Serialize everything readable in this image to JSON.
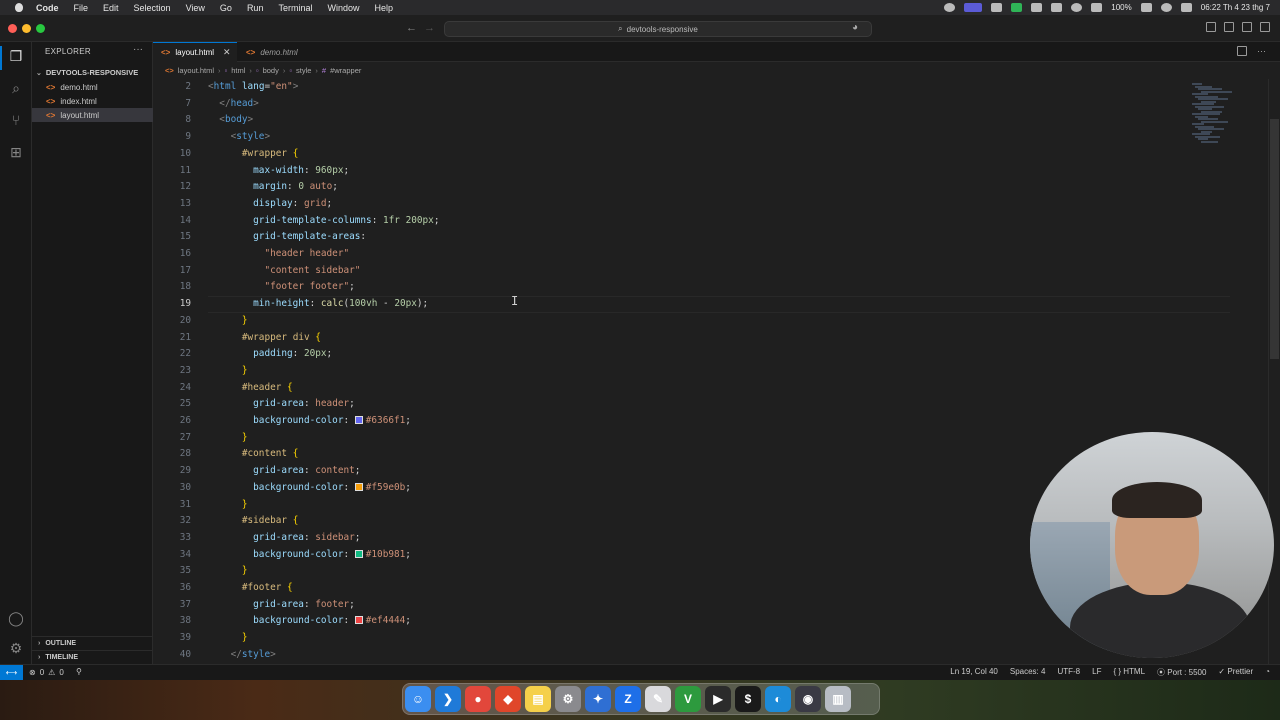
{
  "menubar": {
    "app_name": "Code",
    "items": [
      "File",
      "Edit",
      "Selection",
      "View",
      "Go",
      "Run",
      "Terminal",
      "Window",
      "Help"
    ],
    "battery": "100%",
    "datetime": "06:22 Th 4 23 thg 7"
  },
  "titlebar": {
    "search_text": "devtools-responsive"
  },
  "sidebar": {
    "title": "EXPLORER",
    "folder": "DEVTOOLS-RESPONSIVE",
    "files": [
      {
        "name": "demo.html"
      },
      {
        "name": "index.html"
      },
      {
        "name": "layout.html"
      }
    ],
    "outline_label": "OUTLINE",
    "timeline_label": "TIMELINE"
  },
  "tabs": [
    {
      "label": "layout.html"
    },
    {
      "label": "demo.html"
    }
  ],
  "breadcrumbs": [
    "layout.html",
    "html",
    "body",
    "style",
    "#wrapper"
  ],
  "editor": {
    "current_line": "19",
    "lines": [
      {
        "n": "2",
        "parts": [
          [
            "t-punc",
            "<"
          ],
          [
            "t-tag",
            "html"
          ],
          [
            "t-txt",
            " "
          ],
          [
            "t-attr",
            "lang"
          ],
          [
            "t-txt",
            "="
          ],
          [
            "t-str",
            "\"en\""
          ],
          [
            "t-punc",
            ">"
          ]
        ]
      },
      {
        "n": "7",
        "parts": [
          [
            "t-txt",
            "  "
          ],
          [
            "t-punc",
            "</"
          ],
          [
            "t-tag",
            "head"
          ],
          [
            "t-punc",
            ">"
          ]
        ]
      },
      {
        "n": "8",
        "parts": [
          [
            "t-txt",
            "  "
          ],
          [
            "t-punc",
            "<"
          ],
          [
            "t-tag",
            "body"
          ],
          [
            "t-punc",
            ">"
          ]
        ]
      },
      {
        "n": "9",
        "parts": [
          [
            "t-txt",
            "    "
          ],
          [
            "t-punc",
            "<"
          ],
          [
            "t-tag",
            "style"
          ],
          [
            "t-punc",
            ">"
          ]
        ]
      },
      {
        "n": "10",
        "parts": [
          [
            "t-txt",
            "      "
          ],
          [
            "t-sel",
            "#wrapper"
          ],
          [
            "t-txt",
            " "
          ],
          [
            "t-brace",
            "{"
          ]
        ]
      },
      {
        "n": "11",
        "parts": [
          [
            "t-txt",
            "        "
          ],
          [
            "t-prop",
            "max-width"
          ],
          [
            "t-txt",
            ": "
          ],
          [
            "t-num",
            "960px"
          ],
          [
            "t-txt",
            ";"
          ]
        ]
      },
      {
        "n": "12",
        "parts": [
          [
            "t-txt",
            "        "
          ],
          [
            "t-prop",
            "margin"
          ],
          [
            "t-txt",
            ": "
          ],
          [
            "t-num",
            "0"
          ],
          [
            "t-txt",
            " "
          ],
          [
            "t-val",
            "auto"
          ],
          [
            "t-txt",
            ";"
          ]
        ]
      },
      {
        "n": "13",
        "parts": [
          [
            "t-txt",
            "        "
          ],
          [
            "t-prop",
            "display"
          ],
          [
            "t-txt",
            ": "
          ],
          [
            "t-val",
            "grid"
          ],
          [
            "t-txt",
            ";"
          ]
        ]
      },
      {
        "n": "14",
        "parts": [
          [
            "t-txt",
            "        "
          ],
          [
            "t-prop",
            "grid-template-columns"
          ],
          [
            "t-txt",
            ": "
          ],
          [
            "t-num",
            "1fr"
          ],
          [
            "t-txt",
            " "
          ],
          [
            "t-num",
            "200px"
          ],
          [
            "t-txt",
            ";"
          ]
        ]
      },
      {
        "n": "15",
        "parts": [
          [
            "t-txt",
            "        "
          ],
          [
            "t-prop",
            "grid-template-areas"
          ],
          [
            "t-txt",
            ":"
          ]
        ]
      },
      {
        "n": "16",
        "parts": [
          [
            "t-txt",
            "          "
          ],
          [
            "t-str",
            "\"header header\""
          ]
        ]
      },
      {
        "n": "17",
        "parts": [
          [
            "t-txt",
            "          "
          ],
          [
            "t-str",
            "\"content sidebar\""
          ]
        ]
      },
      {
        "n": "18",
        "parts": [
          [
            "t-txt",
            "          "
          ],
          [
            "t-str",
            "\"footer footer\""
          ],
          [
            "t-txt",
            ";"
          ]
        ]
      },
      {
        "n": "19",
        "parts": [
          [
            "t-txt",
            "        "
          ],
          [
            "t-prop",
            "min-height"
          ],
          [
            "t-txt",
            ": "
          ],
          [
            "t-fn",
            "calc"
          ],
          [
            "t-txt",
            "("
          ],
          [
            "t-num",
            "100vh"
          ],
          [
            "t-txt",
            " - "
          ],
          [
            "t-num",
            "20px"
          ],
          [
            "t-txt",
            ");"
          ]
        ]
      },
      {
        "n": "20",
        "parts": [
          [
            "t-txt",
            "      "
          ],
          [
            "t-brace",
            "}"
          ]
        ]
      },
      {
        "n": "21",
        "parts": [
          [
            "t-txt",
            "      "
          ],
          [
            "t-sel",
            "#wrapper"
          ],
          [
            "t-txt",
            " "
          ],
          [
            "t-sel",
            "div"
          ],
          [
            "t-txt",
            " "
          ],
          [
            "t-brace",
            "{"
          ]
        ]
      },
      {
        "n": "22",
        "parts": [
          [
            "t-txt",
            "        "
          ],
          [
            "t-prop",
            "padding"
          ],
          [
            "t-txt",
            ": "
          ],
          [
            "t-num",
            "20px"
          ],
          [
            "t-txt",
            ";"
          ]
        ]
      },
      {
        "n": "23",
        "parts": [
          [
            "t-txt",
            "      "
          ],
          [
            "t-brace",
            "}"
          ]
        ]
      },
      {
        "n": "24",
        "parts": [
          [
            "t-txt",
            "      "
          ],
          [
            "t-sel",
            "#header"
          ],
          [
            "t-txt",
            " "
          ],
          [
            "t-brace",
            "{"
          ]
        ]
      },
      {
        "n": "25",
        "parts": [
          [
            "t-txt",
            "        "
          ],
          [
            "t-prop",
            "grid-area"
          ],
          [
            "t-txt",
            ": "
          ],
          [
            "t-val",
            "header"
          ],
          [
            "t-txt",
            ";"
          ]
        ]
      },
      {
        "n": "26",
        "parts": [
          [
            "t-txt",
            "        "
          ],
          [
            "t-prop",
            "background-color"
          ],
          [
            "t-txt",
            ": "
          ],
          [
            "swatch",
            "#6366f1"
          ],
          [
            "t-val",
            "#6366f1"
          ],
          [
            "t-txt",
            ";"
          ]
        ]
      },
      {
        "n": "27",
        "parts": [
          [
            "t-txt",
            "      "
          ],
          [
            "t-brace",
            "}"
          ]
        ]
      },
      {
        "n": "28",
        "parts": [
          [
            "t-txt",
            "      "
          ],
          [
            "t-sel",
            "#content"
          ],
          [
            "t-txt",
            " "
          ],
          [
            "t-brace",
            "{"
          ]
        ]
      },
      {
        "n": "29",
        "parts": [
          [
            "t-txt",
            "        "
          ],
          [
            "t-prop",
            "grid-area"
          ],
          [
            "t-txt",
            ": "
          ],
          [
            "t-val",
            "content"
          ],
          [
            "t-txt",
            ";"
          ]
        ]
      },
      {
        "n": "30",
        "parts": [
          [
            "t-txt",
            "        "
          ],
          [
            "t-prop",
            "background-color"
          ],
          [
            "t-txt",
            ": "
          ],
          [
            "swatch",
            "#f59e0b"
          ],
          [
            "t-val",
            "#f59e0b"
          ],
          [
            "t-txt",
            ";"
          ]
        ]
      },
      {
        "n": "31",
        "parts": [
          [
            "t-txt",
            "      "
          ],
          [
            "t-brace",
            "}"
          ]
        ]
      },
      {
        "n": "32",
        "parts": [
          [
            "t-txt",
            "      "
          ],
          [
            "t-sel",
            "#sidebar"
          ],
          [
            "t-txt",
            " "
          ],
          [
            "t-brace",
            "{"
          ]
        ]
      },
      {
        "n": "33",
        "parts": [
          [
            "t-txt",
            "        "
          ],
          [
            "t-prop",
            "grid-area"
          ],
          [
            "t-txt",
            ": "
          ],
          [
            "t-val",
            "sidebar"
          ],
          [
            "t-txt",
            ";"
          ]
        ]
      },
      {
        "n": "34",
        "parts": [
          [
            "t-txt",
            "        "
          ],
          [
            "t-prop",
            "background-color"
          ],
          [
            "t-txt",
            ": "
          ],
          [
            "swatch",
            "#10b981"
          ],
          [
            "t-val",
            "#10b981"
          ],
          [
            "t-txt",
            ";"
          ]
        ]
      },
      {
        "n": "35",
        "parts": [
          [
            "t-txt",
            "      "
          ],
          [
            "t-brace",
            "}"
          ]
        ]
      },
      {
        "n": "36",
        "parts": [
          [
            "t-txt",
            "      "
          ],
          [
            "t-sel",
            "#footer"
          ],
          [
            "t-txt",
            " "
          ],
          [
            "t-brace",
            "{"
          ]
        ]
      },
      {
        "n": "37",
        "parts": [
          [
            "t-txt",
            "        "
          ],
          [
            "t-prop",
            "grid-area"
          ],
          [
            "t-txt",
            ": "
          ],
          [
            "t-val",
            "footer"
          ],
          [
            "t-txt",
            ";"
          ]
        ]
      },
      {
        "n": "38",
        "parts": [
          [
            "t-txt",
            "        "
          ],
          [
            "t-prop",
            "background-color"
          ],
          [
            "t-txt",
            ": "
          ],
          [
            "swatch",
            "#ef4444"
          ],
          [
            "t-val",
            "#ef4444"
          ],
          [
            "t-txt",
            ";"
          ]
        ]
      },
      {
        "n": "39",
        "parts": [
          [
            "t-txt",
            "      "
          ],
          [
            "t-brace",
            "}"
          ]
        ]
      },
      {
        "n": "40",
        "parts": [
          [
            "t-txt",
            "    "
          ],
          [
            "t-punc",
            "</"
          ],
          [
            "t-tag",
            "style"
          ],
          [
            "t-punc",
            ">"
          ]
        ]
      }
    ]
  },
  "statusbar": {
    "errors": "0",
    "warnings": "0",
    "position": "Ln 19, Col 40",
    "spaces": "Spaces: 4",
    "encoding": "UTF-8",
    "eol": "LF",
    "language": "HTML",
    "port": "Port : 5500",
    "formatter": "Prettier"
  },
  "dock": {
    "icons": [
      {
        "name": "finder-icon",
        "color": "#3b8ef0",
        "glyph": "☺"
      },
      {
        "name": "vscode-icon",
        "color": "#1f7ad8",
        "glyph": "❯"
      },
      {
        "name": "chrome-icon",
        "color": "#e2473b",
        "glyph": "●"
      },
      {
        "name": "scrap-icon",
        "color": "#e0462a",
        "glyph": "◆"
      },
      {
        "name": "notes-icon",
        "color": "#f5d04a",
        "glyph": "▤"
      },
      {
        "name": "settings-icon",
        "color": "#8a8a8e",
        "glyph": "⚙"
      },
      {
        "name": "xcode-icon",
        "color": "#2f6fd3",
        "glyph": "✦"
      },
      {
        "name": "zalo-icon",
        "color": "#1e6fe8",
        "glyph": "Z"
      },
      {
        "name": "scripts-icon",
        "color": "#d9d9dc",
        "glyph": "✎"
      },
      {
        "name": "vim-icon",
        "color": "#2d9a3e",
        "glyph": "V"
      },
      {
        "name": "terminal-icon",
        "color": "#2b2b2b",
        "glyph": "▶"
      },
      {
        "name": "iterm-icon",
        "color": "#1a1a1a",
        "glyph": "$"
      },
      {
        "name": "edge-icon",
        "color": "#1d8bd8",
        "glyph": "◐"
      },
      {
        "name": "obs-icon",
        "color": "#3a3a44",
        "glyph": "◉"
      },
      {
        "name": "trash-icon",
        "color": "#b7bcc4",
        "glyph": "▥"
      }
    ]
  }
}
